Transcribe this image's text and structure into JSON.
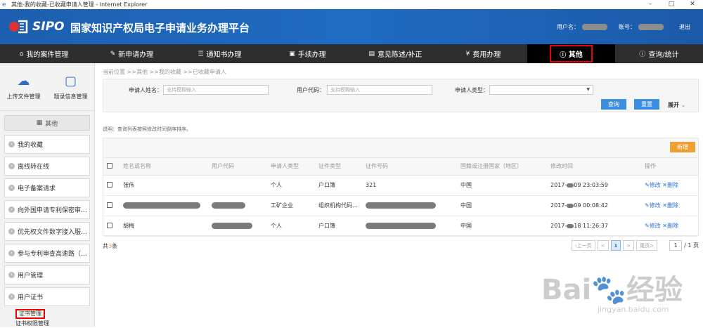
{
  "window": {
    "title": "其他-我的收藏-已收藏申请人管理 - Internet Explorer"
  },
  "header": {
    "brand": "SIPO",
    "platform_name": "国家知识产权局电子申请业务办理平台",
    "username_label": "用户名：",
    "account_label": "账号：",
    "logout": "退出"
  },
  "nav": {
    "items": [
      {
        "label": "我的案件管理",
        "icon": "home-icon"
      },
      {
        "label": "新申请办理",
        "icon": "edit-icon"
      },
      {
        "label": "通知书办理",
        "icon": "list-icon"
      },
      {
        "label": "手续办理",
        "icon": "doc-icon"
      },
      {
        "label": "意见陈述/补正",
        "icon": "doc-icon"
      },
      {
        "label": "费用办理",
        "icon": "yen-icon"
      },
      {
        "label": "其他",
        "icon": "info-icon",
        "active": true
      },
      {
        "label": "查询/统计",
        "icon": "info-icon"
      }
    ]
  },
  "sidebar": {
    "top": [
      {
        "label": "上传文件管理",
        "icon": "cloud-upload-icon"
      },
      {
        "label": "题录信息管理",
        "icon": "chat-icon"
      }
    ],
    "section_title": "其他",
    "menu": [
      {
        "label": "我的收藏"
      },
      {
        "label": "离线转在线"
      },
      {
        "label": "电子备案请求"
      },
      {
        "label": "向外国申请专利保密审…"
      },
      {
        "label": "优先权文件数字接入服…"
      },
      {
        "label": "参与专利审查高速路（…"
      },
      {
        "label": "用户管理"
      },
      {
        "label": "用户证书"
      }
    ],
    "submenu": [
      {
        "label": "证书管理",
        "active": true
      },
      {
        "label": "证书权限管理"
      }
    ]
  },
  "breadcrumb": "当前位置 >>其他 >>我的收藏 >>已收藏申请人",
  "search": {
    "name_label": "申请人姓名：",
    "name_placeholder": "支持模糊输入",
    "code_label": "用户代码：",
    "code_placeholder": "支持模糊输入",
    "type_label": "申请人类型：",
    "query_btn": "查询",
    "reset_btn": "重置",
    "expand": "展开"
  },
  "note": "说明：查询列表按照修改时间倒序排序。",
  "add_btn": "新增",
  "table": {
    "headers": [
      "姓名或名称",
      "用户代码",
      "申请人类型",
      "证件类型",
      "证件号码",
      "国籍或注册国家（地区）",
      "修改时间",
      "操作"
    ],
    "rows": [
      {
        "name": "张伟",
        "type": "个人",
        "id_type": "户口簿",
        "id_no": "321",
        "country": "中国",
        "time_a": "2017-",
        "time_b": "09 23:03:59"
      },
      {
        "name": "",
        "type": "工矿企业",
        "id_type": "组织机构代码…",
        "id_no": "",
        "country": "中国",
        "time_a": "2017-",
        "time_b": "09 00:08:42"
      },
      {
        "name": "胡梅",
        "type": "个人",
        "id_type": "户口簿",
        "id_no": "",
        "country": "中国",
        "time_a": "2017-",
        "time_b": "18 11:26:37"
      }
    ],
    "edit": "修改",
    "delete": "删除"
  },
  "footer": {
    "total_prefix": "共",
    "total_count": "3",
    "total_suffix": "条",
    "prev": "上一页",
    "page_prev_arrow": "<",
    "current_page": "1",
    "page_next_arrow": ">",
    "last": "尾页",
    "last_arrow": ">",
    "goto_value": "1",
    "page_total": "/ 1 页"
  },
  "watermark": {
    "brand": "Bai",
    "brand_cn": "经验",
    "url": "jingyan.baidu.com"
  },
  "colors": {
    "header_blue": "#1f6bc3",
    "nav_bg": "#2e2e2e",
    "highlight_red": "#ee0000",
    "button_blue": "#3b8fe0",
    "button_orange": "#f0a030",
    "link_blue": "#2a6fd0"
  }
}
